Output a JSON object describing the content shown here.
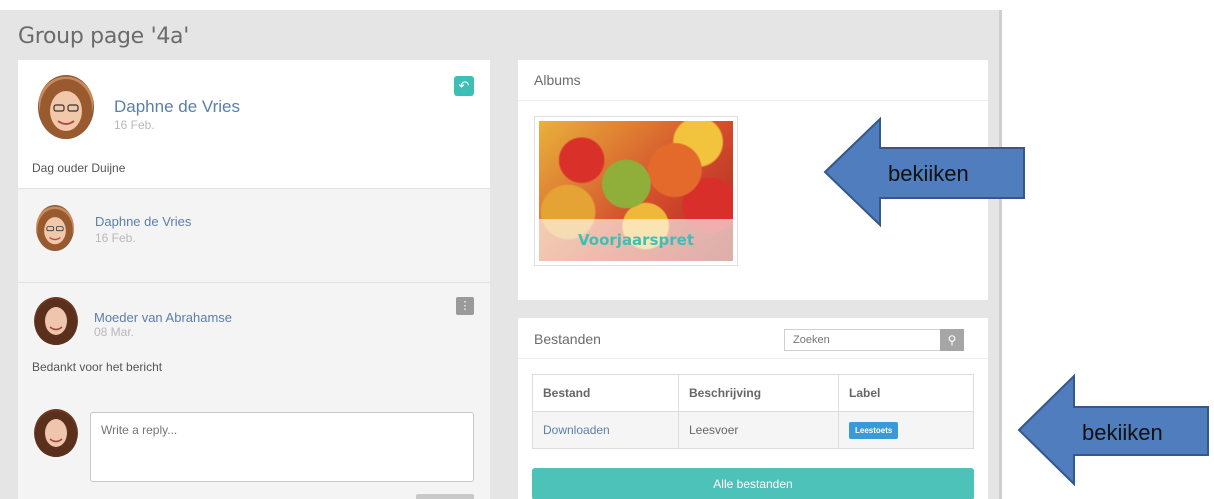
{
  "page": {
    "title": "Group page '4a'"
  },
  "post": {
    "author": "Daphne de Vries",
    "date": "16 Feb.",
    "text": "Dag ouder Duijne",
    "reply_icon": "reply-icon"
  },
  "comments": [
    {
      "author": "Daphne de Vries",
      "date": "16 Feb.",
      "text": ""
    },
    {
      "author": "Moeder van Abrahamse",
      "date": "08 Mar.",
      "text": "Bedankt voor het bericht",
      "menu_icon": "info-icon"
    }
  ],
  "reply": {
    "placeholder": "Write a reply..."
  },
  "albums": {
    "heading": "Albums",
    "items": [
      {
        "label": "Voorjaarspret"
      }
    ]
  },
  "files": {
    "heading": "Bestanden",
    "search_placeholder": "Zoeken",
    "search_icon": "search-icon",
    "columns": [
      "Bestand",
      "Beschrijving",
      "Label"
    ],
    "rows": [
      {
        "file": "Downloaden",
        "description": "Leesvoer",
        "label": "Leestoets"
      }
    ],
    "all_files_label": "Alle bestanden"
  },
  "annotations": [
    {
      "text": "bekiiken"
    },
    {
      "text": "bekiiken"
    }
  ],
  "colors": {
    "accent": "#3dbfb6",
    "link": "#5b7fa8",
    "tag": "#3a9ad9",
    "arrow_fill": "#4f7dbd",
    "arrow_stroke": "#35578a"
  }
}
